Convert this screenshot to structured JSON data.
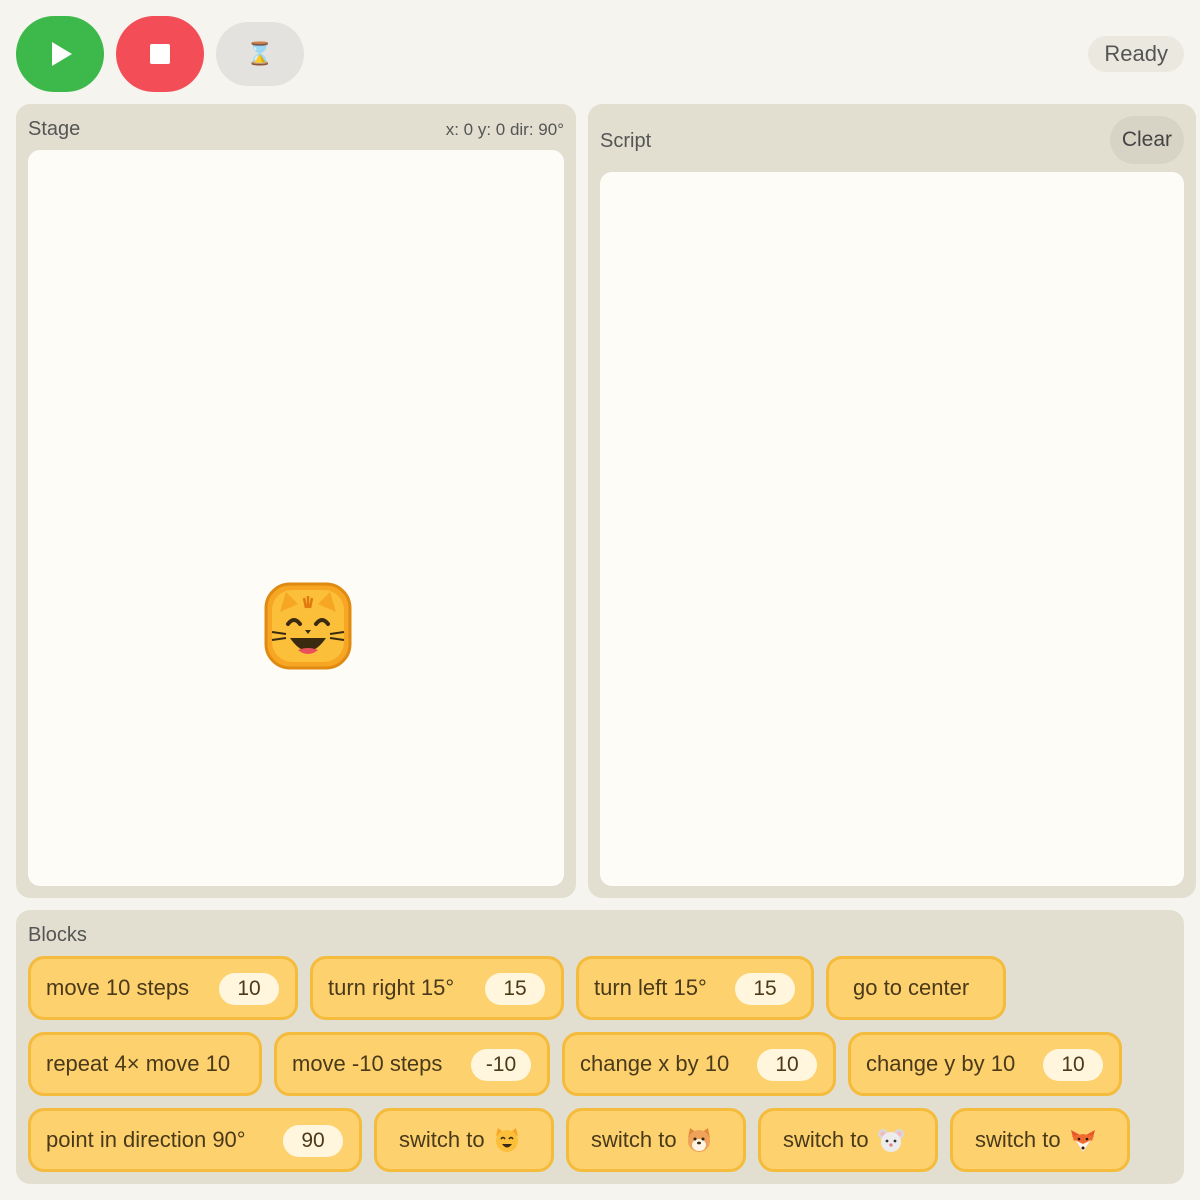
{
  "toolbar": {
    "go_icon": "play-icon",
    "stop_icon": "stop-icon",
    "step_label": "⌛",
    "status": "Ready",
    "colors": {
      "go": "#3cb94a",
      "stop": "#f34d57"
    }
  },
  "stage": {
    "title": "Stage",
    "coords": "x: 0 y: 0 dir: 90°",
    "sprite": "cat-face-icon"
  },
  "script": {
    "title": "Script",
    "clear_label": "Clear"
  },
  "blocks": {
    "title": "Blocks",
    "items": [
      {
        "label": "move 10 steps",
        "value": "10"
      },
      {
        "label": "turn right 15°",
        "value": "15"
      },
      {
        "label": "turn left 15°",
        "value": "15"
      },
      {
        "label": "go to center"
      },
      {
        "label": "repeat 4× move 10"
      },
      {
        "label": "move -10 steps",
        "value": "-10"
      },
      {
        "label": "change x by 10",
        "value": "10"
      },
      {
        "label": "change y by 10",
        "value": "10"
      },
      {
        "label": "point in direction 90°",
        "value": "90"
      },
      {
        "label": "switch to",
        "icon": "cat-face-icon"
      },
      {
        "label": "switch to",
        "icon": "dog-face-icon"
      },
      {
        "label": "switch to",
        "icon": "mouse-face-icon"
      },
      {
        "label": "switch to",
        "icon": "fox-face-icon"
      }
    ]
  }
}
